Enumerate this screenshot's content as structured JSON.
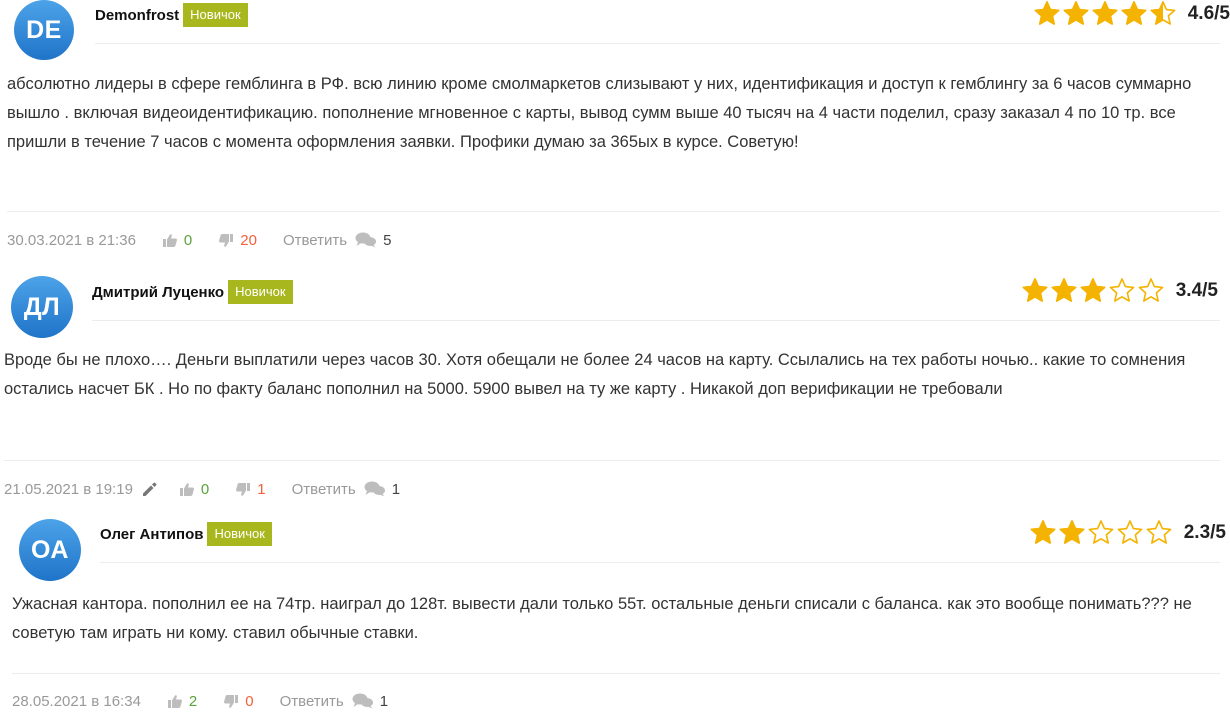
{
  "colors": {
    "avatar_gradient_top": "#4da3e8",
    "avatar_gradient_bottom": "#1f74c9",
    "badge": "#a9b71f",
    "star_filled": "#f5b301",
    "star_empty_outline": "#f5b301",
    "likes": "#5aa33b",
    "dislikes": "#f0623a",
    "meta_text": "#999999"
  },
  "reviews": [
    {
      "avatar": "DE",
      "name": "Demonfrost",
      "badge": "Новичок",
      "rating": 4.5,
      "rating_label": "4.6/5",
      "text": "абсолютно лидеры в сфере гемблинга в РФ. всю линию кроме смолмаркетов слизывают у них, идентификация и доступ к гемблингу за 6 часов суммарно вышло . включая видеоидентификацию. пополнение мгновенное с карты, вывод сумм выше 40 тысяч на 4 части поделил, сразу заказал 4 по 10 тр. все пришли в течение 7 часов с момента оформления заявки. Профики думаю за 365ых в курсе. Советую!",
      "date": "30.03.2021 в 21:36",
      "edited": false,
      "likes": "0",
      "dislikes": "20",
      "reply_label": "Ответить",
      "comments": "5"
    },
    {
      "avatar": "ДЛ",
      "name": "Дмитрий Луценко",
      "badge": "Новичок",
      "rating": 3,
      "rating_label": "3.4/5",
      "text": "Вроде бы не плохо…. Деньги выплатили через часов 30. Хотя обещали не более 24 часов на карту. Ссылались на тех работы ночью.. какие то сомнения остались насчет БК . Но по факту баланс пополнил на 5000. 5900 вывел на ту же карту . Никакой доп верификации не требовали",
      "date": "21.05.2021 в 19:19",
      "edited": true,
      "likes": "0",
      "dislikes": "1",
      "reply_label": "Ответить",
      "comments": "1"
    },
    {
      "avatar": "ОА",
      "name": "Олег Антипов",
      "badge": "Новичок",
      "rating": 2,
      "rating_label": "2.3/5",
      "text": "Ужасная кантора. пополнил ее на 74тр. наиграл до 128т. вывести дали только 55т. остальные деньги списали с баланса. как это вообще понимать??? не советую там играть ни кому. ставил обычные ставки.",
      "date": "28.05.2021 в 16:34",
      "edited": false,
      "likes": "2",
      "dislikes": "0",
      "reply_label": "Ответить",
      "comments": "1"
    }
  ]
}
